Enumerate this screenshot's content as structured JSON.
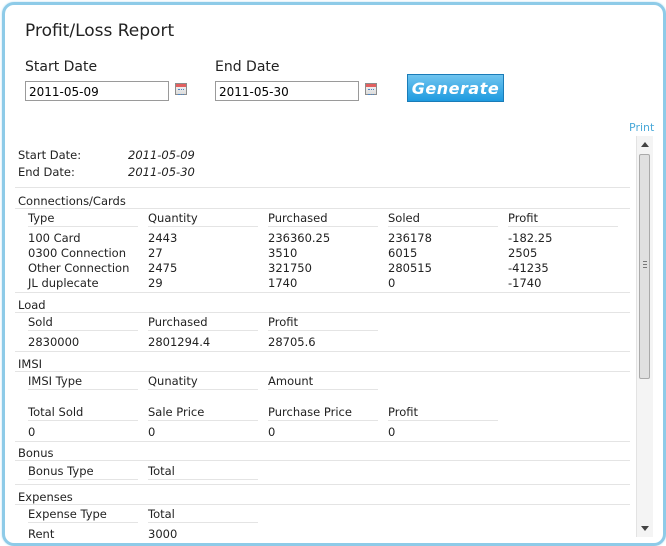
{
  "title": "Profit/Loss Report",
  "form": {
    "start_label": "Start Date",
    "start_value": "2011-05-09",
    "end_label": "End Date",
    "end_value": "2011-05-30",
    "generate_label": "Generate"
  },
  "print_label": "Print",
  "report": {
    "start_label": "Start Date:",
    "start_value": "2011-05-09",
    "end_label": "End Date:",
    "end_value": "2011-05-30",
    "connections": {
      "title": "Connections/Cards",
      "headers": [
        "Type",
        "Quantity",
        "Purchased",
        "Soled",
        "Profit"
      ],
      "rows": [
        [
          "100 Card",
          "2443",
          "236360.25",
          "236178",
          "-182.25"
        ],
        [
          "0300 Connection",
          "27",
          "3510",
          "6015",
          "2505"
        ],
        [
          "Other Connection",
          "2475",
          "321750",
          "280515",
          "-41235"
        ],
        [
          "JL duplecate",
          "29",
          "1740",
          "0",
          "-1740"
        ]
      ]
    },
    "load": {
      "title": "Load",
      "headers": [
        "Sold",
        "Purchased",
        "Profit"
      ],
      "values": [
        "2830000",
        "2801294.4",
        "28705.6"
      ]
    },
    "imsi": {
      "title": "IMSI",
      "headers": [
        "IMSI Type",
        "Qunatity",
        "Amount"
      ],
      "totals_headers": [
        "Total Sold",
        "Sale Price",
        "Purchase Price",
        "Profit"
      ],
      "totals_values": [
        "0",
        "0",
        "0",
        "0"
      ]
    },
    "bonus": {
      "title": "Bonus",
      "headers": [
        "Bonus Type",
        "Total"
      ]
    },
    "expenses": {
      "title": "Expenses",
      "headers": [
        "Expense Type",
        "Total"
      ],
      "rows": [
        [
          "Rent",
          "3000"
        ]
      ]
    }
  }
}
